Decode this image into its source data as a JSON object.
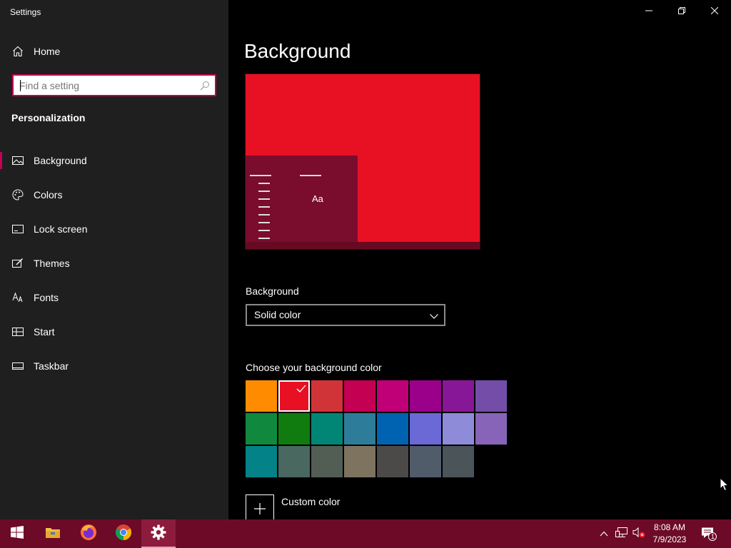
{
  "window": {
    "title": "Settings",
    "buttons": {
      "minimize_icon": "minimize-icon",
      "restore_icon": "restore-icon",
      "close_icon": "close-icon"
    }
  },
  "sidebar": {
    "home_label": "Home",
    "search_placeholder": "Find a setting",
    "section_title": "Personalization",
    "items": [
      {
        "label": "Background",
        "icon": "picture-icon",
        "active": true
      },
      {
        "label": "Colors",
        "icon": "palette-icon",
        "active": false
      },
      {
        "label": "Lock screen",
        "icon": "lock-screen-icon",
        "active": false
      },
      {
        "label": "Themes",
        "icon": "themes-icon",
        "active": false
      },
      {
        "label": "Fonts",
        "icon": "fonts-icon",
        "active": false
      },
      {
        "label": "Start",
        "icon": "start-icon",
        "active": false
      },
      {
        "label": "Taskbar",
        "icon": "taskbar-icon",
        "active": false
      }
    ]
  },
  "main": {
    "page_title": "Background",
    "preview": {
      "sample_text": "Aa",
      "background_color": "#e81123",
      "window_color": "#7a0c2e"
    },
    "background_label": "Background",
    "background_value": "Solid color",
    "choose_label": "Choose your background color",
    "selected_color": "#e81123",
    "colors": [
      [
        "#ff8c00",
        "#e81123",
        "#d13438",
        "#c30052",
        "#bf0077",
        "#9a0089",
        "#881798",
        "#744da9"
      ],
      [
        "#10893e",
        "#107c10",
        "#018574",
        "#2d7d9a",
        "#0063b1",
        "#6b69d6",
        "#8e8cd8",
        "#8764b8"
      ],
      [
        "#038387",
        "#486860",
        "#525e54",
        "#7e735f",
        "#4c4a48",
        "#515c6b",
        "#4a5459"
      ]
    ],
    "custom_color_label": "Custom color"
  },
  "taskbar": {
    "apps": [
      "windows-start-icon",
      "file-explorer-icon",
      "firefox-icon",
      "chrome-icon",
      "settings-gear-icon"
    ],
    "time": "8:08 AM",
    "date": "7/9/2023",
    "notification_count": "1"
  }
}
